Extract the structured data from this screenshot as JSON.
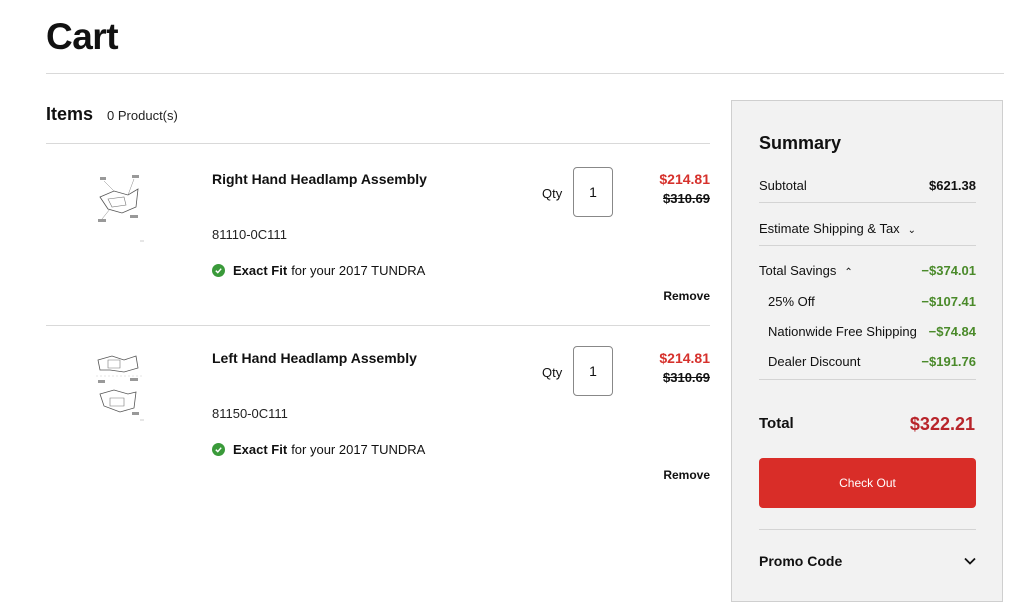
{
  "page": {
    "title": "Cart"
  },
  "items_section": {
    "title": "Items",
    "count": "0 Product(s)"
  },
  "items": [
    {
      "name": "Right Hand Headlamp Assembly",
      "sku": "81110-0C111",
      "fit_label": "Exact Fit",
      "fit_text": "for your 2017 TUNDRA",
      "qty_label": "Qty",
      "qty": "1",
      "price_sale": "$214.81",
      "price_original": "$310.69",
      "remove_label": "Remove"
    },
    {
      "name": "Left Hand Headlamp Assembly",
      "sku": "81150-0C111",
      "fit_label": "Exact Fit",
      "fit_text": "for your 2017 TUNDRA",
      "qty_label": "Qty",
      "qty": "1",
      "price_sale": "$214.81",
      "price_original": "$310.69",
      "remove_label": "Remove"
    }
  ],
  "summary": {
    "title": "Summary",
    "subtotal_label": "Subtotal",
    "subtotal_value": "$621.38",
    "shipping_label": "Estimate Shipping & Tax",
    "savings_label": "Total Savings",
    "savings_value": "−$374.01",
    "discounts": [
      {
        "label": "25% Off",
        "value": "−$107.41"
      },
      {
        "label": "Nationwide Free Shipping",
        "value": "−$74.84"
      },
      {
        "label": "Dealer Discount",
        "value": "−$191.76"
      }
    ],
    "total_label": "Total",
    "total_value": "$322.21",
    "checkout_label": "Check Out",
    "promo_label": "Promo Code"
  },
  "colors": {
    "sale": "#d6312c",
    "savings": "#4a8a2a",
    "total": "#b8242a",
    "checkout": "#d92d28",
    "check_badge": "#3a9a3a"
  },
  "icons": {
    "fit_badge": "check-circle-icon",
    "shipping_toggle": "chevron-down-icon",
    "savings_toggle": "chevron-up-icon",
    "promo_toggle": "chevron-down-icon"
  }
}
